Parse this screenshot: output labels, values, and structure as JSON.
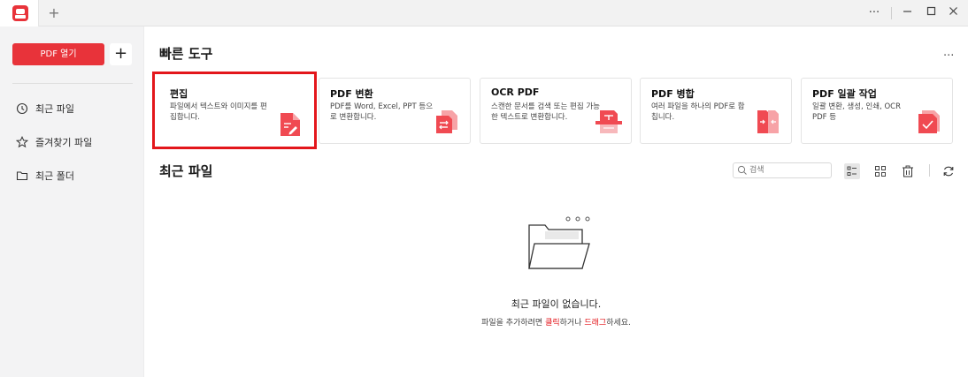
{
  "titlebar": {
    "new_tab_label": "+",
    "more_label": "···",
    "minimize_label": "—",
    "maximize_label": "☐",
    "close_label": "✕"
  },
  "sidebar": {
    "open_pdf_label": "PDF 열기",
    "plus_label": "+",
    "items": [
      {
        "label": "최근 파일",
        "icon": "clock-icon"
      },
      {
        "label": "즐겨찾기 파일",
        "icon": "star-icon"
      },
      {
        "label": "최근 폴더",
        "icon": "folder-icon"
      }
    ]
  },
  "quick_tools": {
    "title": "빠른 도구",
    "more_label": "···",
    "cards": [
      {
        "title": "편집",
        "desc": "파일에서 텍스트와 이미지를 편집합니다.",
        "icon": "edit-pdf-icon"
      },
      {
        "title": "PDF 변환",
        "desc": "PDF를 Word, Excel, PPT 등으로 변환합니다.",
        "icon": "convert-pdf-icon"
      },
      {
        "title": "OCR PDF",
        "desc": "스캔한 문서를 검색 또는 편집 가능한 텍스트로 변환합니다.",
        "icon": "ocr-pdf-icon"
      },
      {
        "title": "PDF 병합",
        "desc": "여러 파일을 하나의 PDF로 합칩니다.",
        "icon": "merge-pdf-icon"
      },
      {
        "title": "PDF 일괄 작업",
        "desc": "일괄 변환, 생성, 인쇄, OCR PDF 등",
        "icon": "batch-pdf-icon"
      }
    ]
  },
  "recent": {
    "title": "최근 파일",
    "search_placeholder": "검색",
    "empty_title": "최근 파일이 없습니다.",
    "empty_sub_prefix": "파일을 추가하려면 ",
    "empty_sub_click": "클릭",
    "empty_sub_middle": "하거나 ",
    "empty_sub_drag": "드래그",
    "empty_sub_suffix": "하세요."
  },
  "colors": {
    "accent": "#e8333a",
    "highlight_border": "#e3161b",
    "sidebar_bg": "#f3f3f4"
  }
}
